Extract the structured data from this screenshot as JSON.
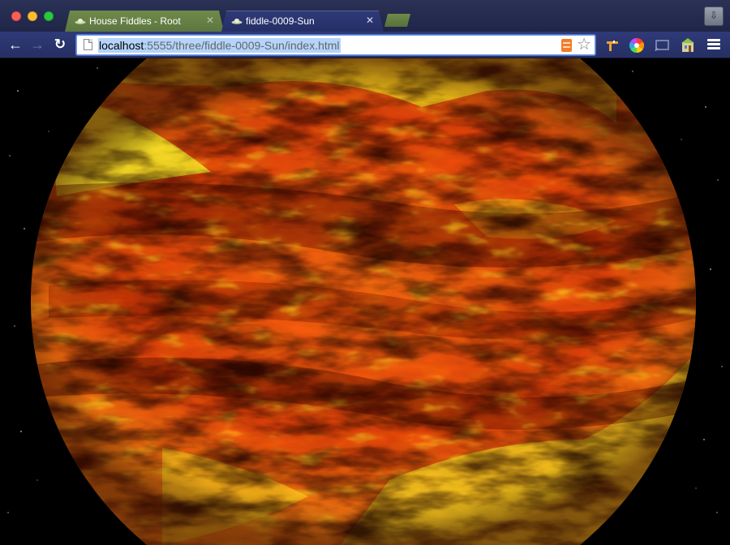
{
  "window": {
    "controls": [
      "close",
      "minimize",
      "maximize"
    ]
  },
  "tabs": [
    {
      "title": "House Fiddles - Root",
      "favicon": "ufo-icon",
      "active": false,
      "close": "✕"
    },
    {
      "title": "fiddle-0009-Sun",
      "favicon": "ufo-icon",
      "active": true,
      "close": "✕"
    }
  ],
  "toolbar": {
    "back": "←",
    "forward": "→",
    "reload": "↻",
    "url_host": "localhost",
    "url_path": ":5555/three/fiddle-0009-Sun/index.html",
    "star": "☆",
    "extensions": [
      "pin-extension-icon",
      "color-wheel-icon",
      "cast-icon",
      "house-extension-icon"
    ],
    "menu": "hamburger-menu-icon"
  },
  "page": {
    "scene": "webgl-sun-sphere",
    "colors": {
      "background": "#000000",
      "sun_bright": "#ffef2a",
      "sun_mid": "#ff7a10",
      "sun_deep": "#c52a05",
      "sun_dark": "#3a0500"
    }
  }
}
